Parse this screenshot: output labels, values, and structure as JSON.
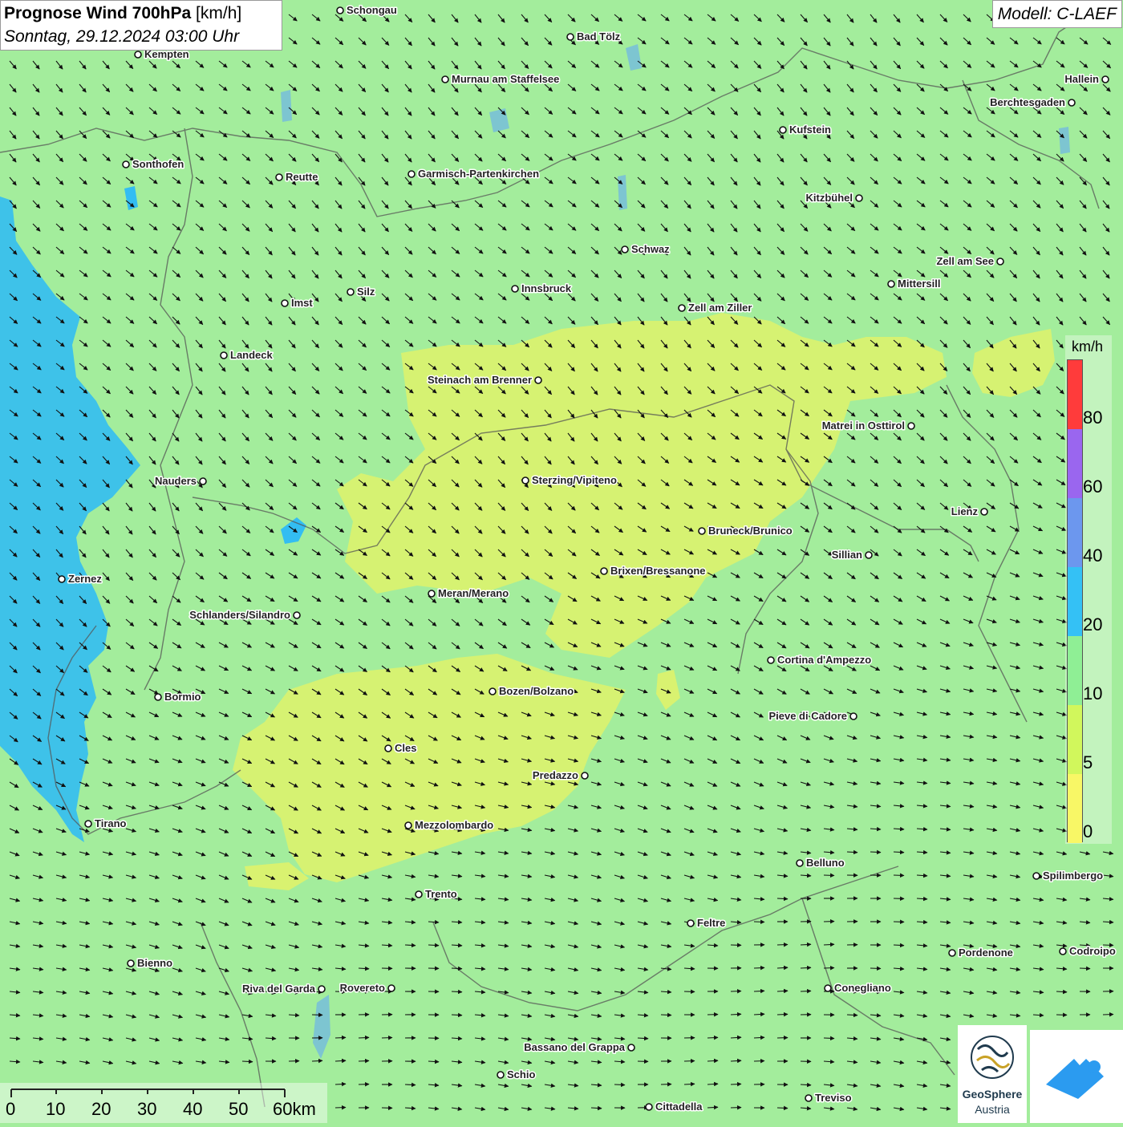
{
  "title": {
    "main": "Prognose Wind 700hPa",
    "unit": "[km/h]",
    "datetime": "Sonntag, 29.12.2024 03:00 Uhr"
  },
  "model_label": "Modell: C-LAEF",
  "legend": {
    "unit": "km/h",
    "ticks": [
      "80",
      "60",
      "40",
      "20",
      "10",
      "5",
      "0"
    ],
    "colors": [
      "#ff3b3b",
      "#c5a1f5",
      "#9a66ef",
      "#6c97ee",
      "#34c1f5",
      "#8fef95",
      "#d1f75c",
      "#f8f766"
    ],
    "color_names": [
      "red",
      "light purple",
      "purple",
      "blue",
      "cyan",
      "green",
      "yellow-green",
      "yellow"
    ]
  },
  "wind_field": {
    "background_color": "#a3ed9c",
    "calm_area_color": "#d9f270",
    "strong_area_color": "#33bdf2",
    "arrow_color": "#111111",
    "direction": "mostly southeast, east in the south"
  },
  "cities": [
    {
      "name": "Schongau"
    },
    {
      "name": "Bad Tölz"
    },
    {
      "name": "Kempten"
    },
    {
      "name": "Murnau am Staffelsee"
    },
    {
      "name": "Hallein"
    },
    {
      "name": "Berchtesgaden"
    },
    {
      "name": "Kufstein"
    },
    {
      "name": "Sonthofen"
    },
    {
      "name": "Reutte"
    },
    {
      "name": "Garmisch-Partenkirchen"
    },
    {
      "name": "Kitzbühel"
    },
    {
      "name": "Schwaz"
    },
    {
      "name": "Zell am See"
    },
    {
      "name": "Mittersill"
    },
    {
      "name": "Silz"
    },
    {
      "name": "Innsbruck"
    },
    {
      "name": "Imst"
    },
    {
      "name": "Zell am Ziller"
    },
    {
      "name": "Landeck"
    },
    {
      "name": "Steinach am Brenner"
    },
    {
      "name": "Matrei in Osttirol"
    },
    {
      "name": "Nauders"
    },
    {
      "name": "Sterzing/Vipiteno"
    },
    {
      "name": "Lienz"
    },
    {
      "name": "Bruneck/Brunico"
    },
    {
      "name": "Sillian"
    },
    {
      "name": "Brixen/Bressanone"
    },
    {
      "name": "Zernez"
    },
    {
      "name": "Meran/Merano"
    },
    {
      "name": "Schlanders/Silandro"
    },
    {
      "name": "Cortina d'Ampezzo"
    },
    {
      "name": "Bozen/Bolzano"
    },
    {
      "name": "Bormio"
    },
    {
      "name": "Pieve di Cadore"
    },
    {
      "name": "Cles"
    },
    {
      "name": "Predazzo"
    },
    {
      "name": "Tirano"
    },
    {
      "name": "Mezzolombardo"
    },
    {
      "name": "Belluno"
    },
    {
      "name": "Spilimbergo"
    },
    {
      "name": "Trento"
    },
    {
      "name": "Feltre"
    },
    {
      "name": "Pordenone"
    },
    {
      "name": "Codroipo"
    },
    {
      "name": "Bienno"
    },
    {
      "name": "Riva del Garda"
    },
    {
      "name": "Rovereto"
    },
    {
      "name": "Conegliano"
    },
    {
      "name": "Bassano del Grappa"
    },
    {
      "name": "Schio"
    },
    {
      "name": "Treviso"
    },
    {
      "name": "Cittadella"
    }
  ],
  "scale_bar": {
    "labels": [
      "0",
      "10",
      "20",
      "30",
      "40",
      "50",
      "60km"
    ]
  },
  "logos": {
    "geosphere_line1": "GeoSphere",
    "geosphere_line2": "Austria"
  }
}
